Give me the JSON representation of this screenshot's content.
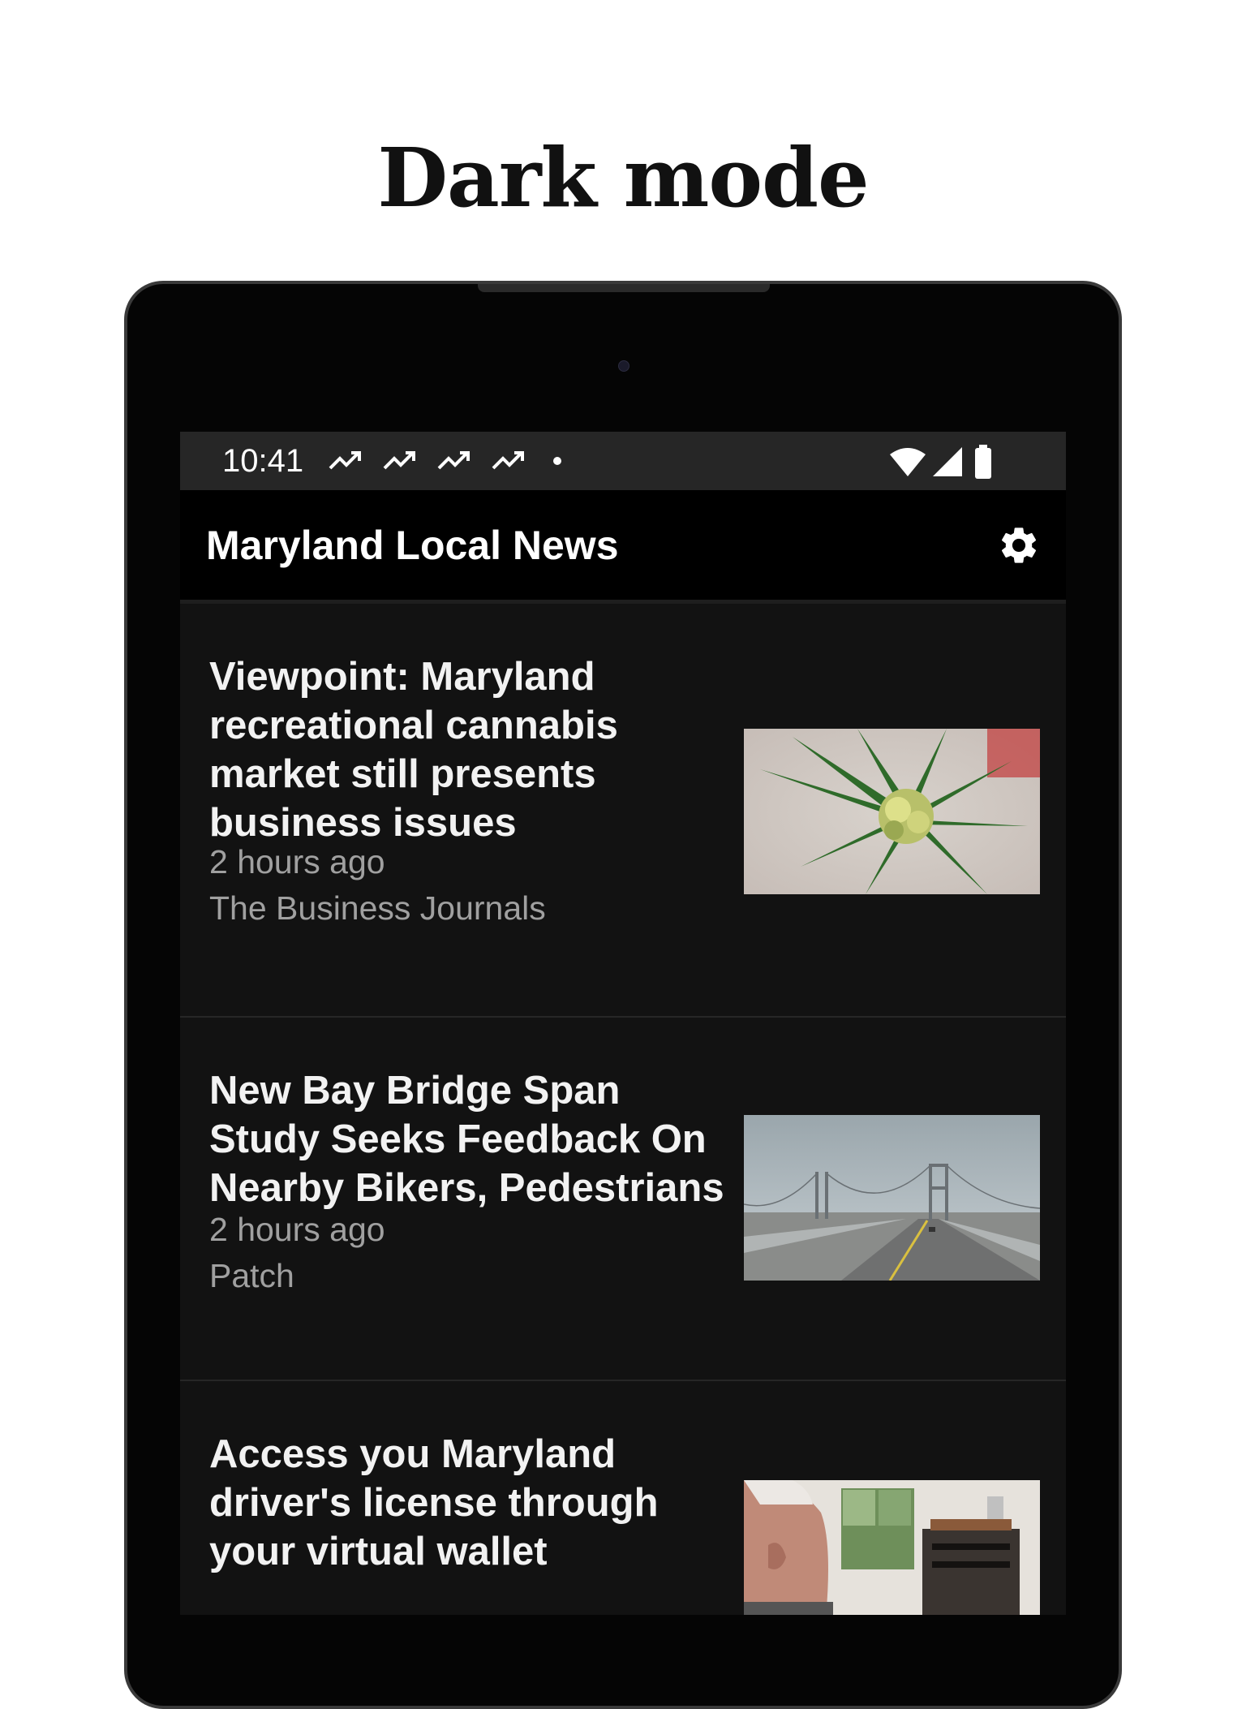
{
  "promo": {
    "title": "Dark mode"
  },
  "status_bar": {
    "time": "10:41",
    "notification_icons": [
      "trending-up-icon",
      "trending-up-icon",
      "trending-up-icon",
      "trending-up-icon",
      "dot-icon"
    ],
    "system_icons": [
      "wifi-icon",
      "cellular-signal-icon",
      "battery-icon"
    ]
  },
  "app_bar": {
    "title": "Maryland Local News",
    "settings_icon": "gear-icon"
  },
  "articles": [
    {
      "headline": "Viewpoint: Maryland recreational cannabis market still presents business issues",
      "time": "2 hours ago",
      "source": "The Business Journals",
      "thumbnail": "cannabis-plant-photo"
    },
    {
      "headline": "New Bay Bridge Span Study Seeks Feedback On Nearby Bikers, Pedestrians",
      "time": "2 hours ago",
      "source": "Patch",
      "thumbnail": "bay-bridge-photo"
    },
    {
      "headline": "Access you Maryland driver's license through your virtual wallet",
      "time": "",
      "source": "",
      "thumbnail": "elderly-man-photo"
    }
  ],
  "colors": {
    "screen_background": "#121212",
    "status_bar": "#262626",
    "app_bar": "#000000",
    "headline_text": "#f2f2f2",
    "meta_text": "#a0a0a0"
  }
}
